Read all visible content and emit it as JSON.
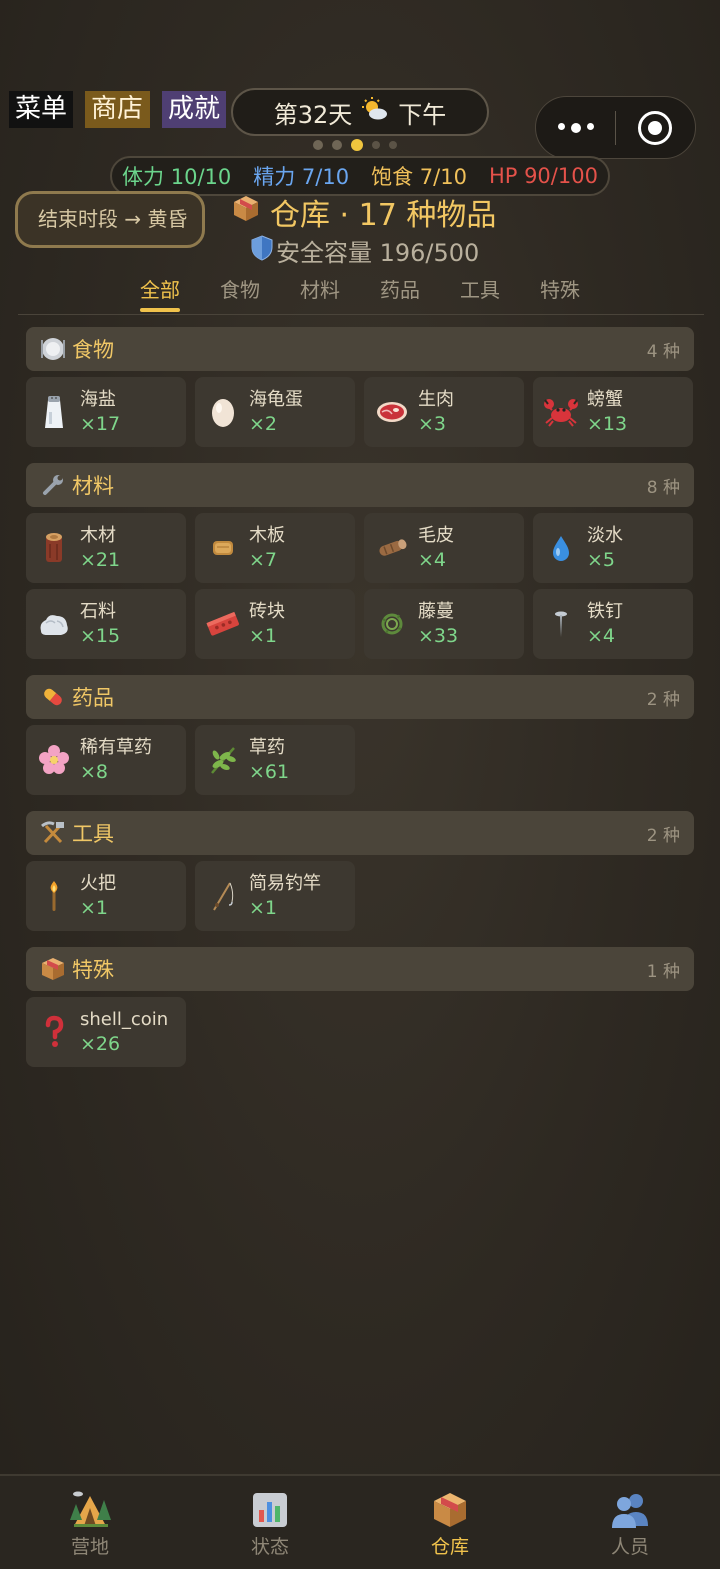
{
  "top_menu": {
    "menu": "菜单",
    "shop": "商店",
    "achievements": "成就"
  },
  "day": {
    "label": "第32天",
    "weather_icon": "sun-cloud-icon",
    "period": "下午"
  },
  "page_dots": {
    "count": 5,
    "active_index": 2
  },
  "stats": {
    "stamina": "体力 10/10",
    "spirit": "精力 7/10",
    "satiety": "饱食 7/10",
    "hp": "HP 90/100"
  },
  "end_period_button": "结束时段 → 黄昏",
  "warehouse": {
    "title": "仓库 · 17 种物品",
    "capacity": "安全容量 196/500"
  },
  "tabs": [
    "全部",
    "食物",
    "材料",
    "药品",
    "工具",
    "特殊"
  ],
  "sections": [
    {
      "name": "食物",
      "count": "4 种",
      "icon": "plate-icon",
      "items": [
        {
          "name": "海盐",
          "qty": "×17",
          "icon": "salt-shaker-icon"
        },
        {
          "name": "海龟蛋",
          "qty": "×2",
          "icon": "egg-icon"
        },
        {
          "name": "生肉",
          "qty": "×3",
          "icon": "meat-icon"
        },
        {
          "name": "螃蟹",
          "qty": "×13",
          "icon": "crab-icon"
        }
      ]
    },
    {
      "name": "材料",
      "count": "8 种",
      "icon": "wrench-icon",
      "items": [
        {
          "name": "木材",
          "qty": "×21",
          "icon": "log-icon"
        },
        {
          "name": "木板",
          "qty": "×7",
          "icon": "plank-icon"
        },
        {
          "name": "毛皮",
          "qty": "×4",
          "icon": "hide-icon"
        },
        {
          "name": "淡水",
          "qty": "×5",
          "icon": "water-drop-icon"
        },
        {
          "name": "石料",
          "qty": "×15",
          "icon": "rock-icon"
        },
        {
          "name": "砖块",
          "qty": "×1",
          "icon": "brick-icon"
        },
        {
          "name": "藤蔓",
          "qty": "×33",
          "icon": "vine-icon"
        },
        {
          "name": "铁钉",
          "qty": "×4",
          "icon": "nail-icon"
        }
      ]
    },
    {
      "name": "药品",
      "count": "2 种",
      "icon": "pill-icon",
      "items": [
        {
          "name": "稀有草药",
          "qty": "×8",
          "icon": "flower-icon"
        },
        {
          "name": "草药",
          "qty": "×61",
          "icon": "herb-icon"
        }
      ]
    },
    {
      "name": "工具",
      "count": "2 种",
      "icon": "hammer-pick-icon",
      "items": [
        {
          "name": "火把",
          "qty": "×1",
          "icon": "torch-icon"
        },
        {
          "name": "简易钓竿",
          "qty": "×1",
          "icon": "fishing-rod-icon"
        }
      ]
    },
    {
      "name": "特殊",
      "count": "1 种",
      "icon": "box-icon",
      "items": [
        {
          "name": "shell_coin",
          "qty": "×26",
          "icon": "question-mark-icon"
        }
      ]
    }
  ],
  "bottom_nav": [
    {
      "label": "营地",
      "icon": "camp-icon"
    },
    {
      "label": "状态",
      "icon": "chart-icon"
    },
    {
      "label": "仓库",
      "icon": "package-icon",
      "active": true
    },
    {
      "label": "人员",
      "icon": "people-icon"
    }
  ]
}
